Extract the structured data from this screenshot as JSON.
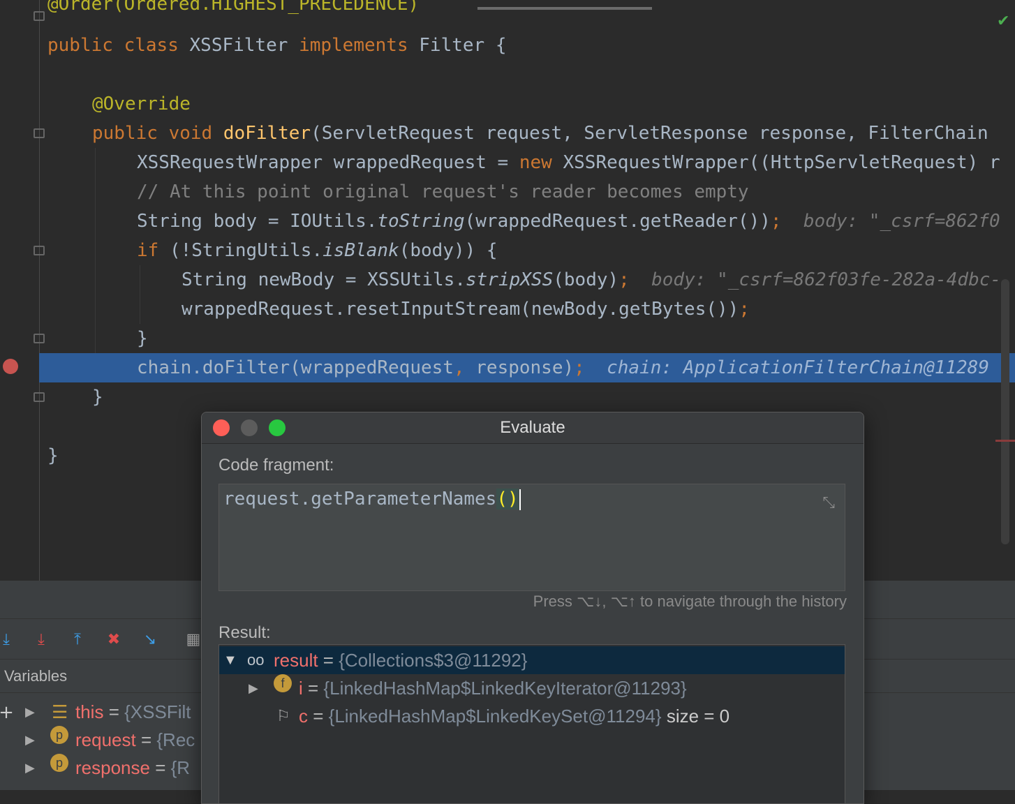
{
  "editor": {
    "top_line": "@Order(Ordered.HIGHEST_PRECEDENCE)",
    "class_decl": {
      "kw1": "public",
      "kw2": "class",
      "name": "XSSFilter",
      "kw3": "implements",
      "iface": "Filter {"
    },
    "override": "@Override",
    "method_sig": {
      "kw1": "public",
      "kw2": "void",
      "name": "doFilter",
      "params": "(ServletRequest request, ServletResponse response, FilterChain"
    },
    "line_wrapper": {
      "a": "XSSRequestWrapper wrappedRequest = ",
      "kw": "new",
      "b": " XSSRequestWrapper((HttpServletRequest) r"
    },
    "line_comment": "// At this point original request's reader becomes empty",
    "line_body": {
      "a": "String body = IOUtils.",
      "st": "toString",
      "b": "(wrappedRequest.getReader())",
      "semi": ";",
      "hint": "body: \"_csrf=862f0"
    },
    "line_if": {
      "kw": "if",
      "a": " (!StringUtils.",
      "st": "isBlank",
      "b": "(body)) {"
    },
    "line_newbody": {
      "a": "String newBody = XSSUtils.",
      "st": "stripXSS",
      "b": "(body)",
      "semi": ";",
      "hint": "body: \"_csrf=862f03fe-282a-4dbc-"
    },
    "line_reset": {
      "a": "wrappedRequest.resetInputStream(newBody.getBytes())",
      "semi": ";"
    },
    "close_if": "}",
    "line_chain": {
      "a": "chain.doFilter(wrappedRequest",
      "comma": ",",
      "b": " response)",
      "semi": ";",
      "hint": "chain: ApplicationFilterChain@11289"
    },
    "close_method": "}",
    "close_class": "}"
  },
  "debug_panel": {
    "variables_title": "Variables",
    "variables": [
      {
        "name": "this",
        "value": "{XSSFilt"
      },
      {
        "name": "request",
        "badge": "p",
        "value": "{Rec"
      },
      {
        "name": "response",
        "badge": "p",
        "value": "{R"
      }
    ]
  },
  "evaluate_dialog": {
    "title": "Evaluate",
    "code_fragment_label": "Code fragment:",
    "code_fragment": {
      "text": "request.getParameterNames",
      "parens": "()"
    },
    "history_hint": "Press ⌥↓, ⌥↑ to navigate through the history",
    "result_label": "Result:",
    "results": [
      {
        "name": "result",
        "value": "{Collections$3@11292}"
      },
      {
        "name": "i",
        "badge": "f",
        "value": "{LinkedHashMap$LinkedKeyIterator@11293}"
      },
      {
        "name": "c",
        "value": "{LinkedHashMap$LinkedKeySet@11294}",
        "extra": "size = 0"
      }
    ]
  },
  "colors": {
    "execution_line": "#2d5c99",
    "keyword": "#cc7832",
    "method": "#ffc66d",
    "variable_name": "#f0706c"
  }
}
